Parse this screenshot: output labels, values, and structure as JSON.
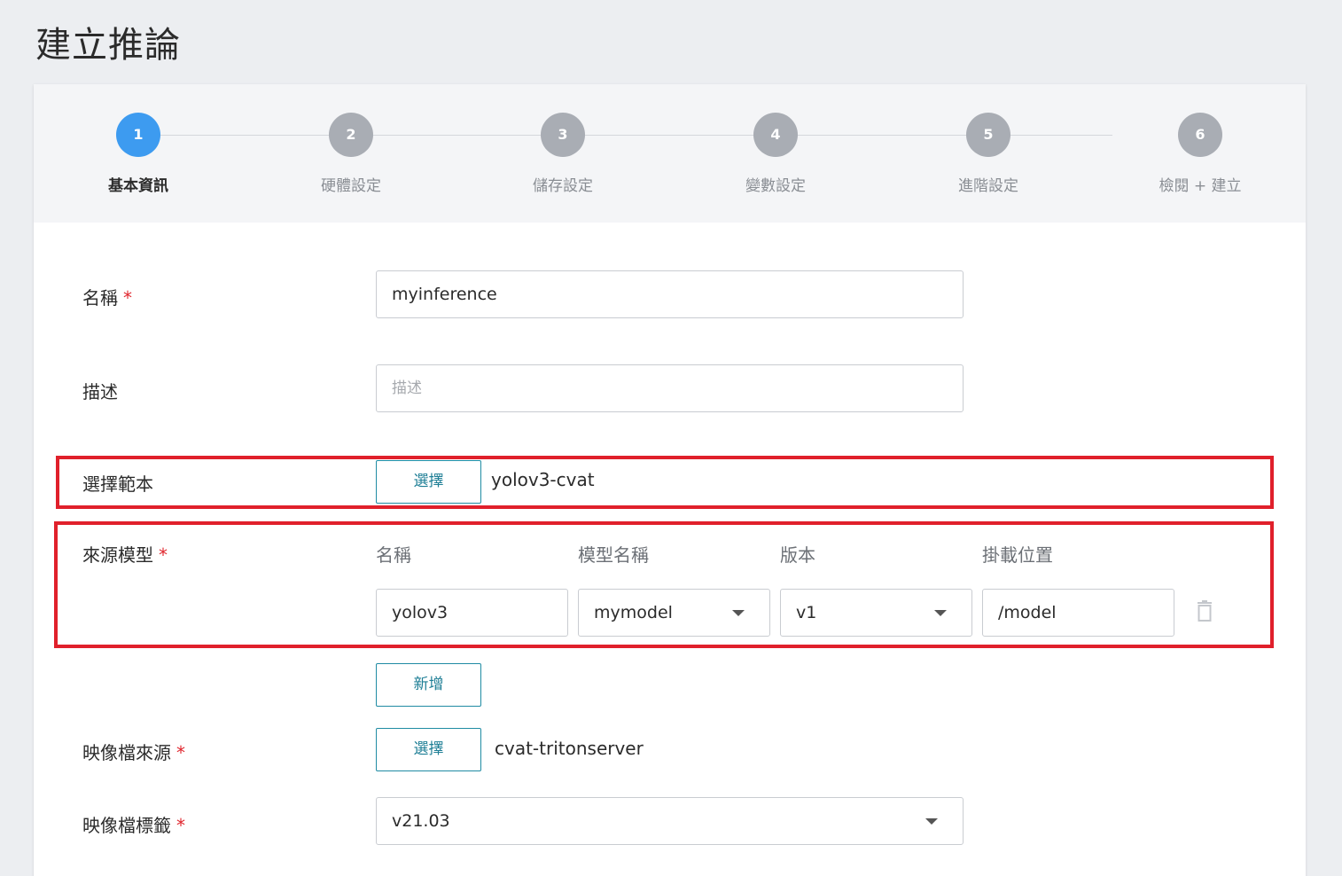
{
  "page": {
    "title": "建立推論"
  },
  "stepper": {
    "steps": [
      {
        "number": "1",
        "label": "基本資訊",
        "active": true
      },
      {
        "number": "2",
        "label": "硬體設定",
        "active": false
      },
      {
        "number": "3",
        "label": "儲存設定",
        "active": false
      },
      {
        "number": "4",
        "label": "變數設定",
        "active": false
      },
      {
        "number": "5",
        "label": "進階設定",
        "active": false
      },
      {
        "number": "6",
        "label": "檢閱 + 建立",
        "active": false
      }
    ]
  },
  "form": {
    "name": {
      "label": "名稱",
      "required_mark": "*",
      "value": "myinference"
    },
    "description": {
      "label": "描述",
      "placeholder": "描述",
      "value": ""
    },
    "template": {
      "label": "選擇範本",
      "button": "選擇",
      "selected": "yolov3-cvat"
    },
    "source_model": {
      "label": "來源模型",
      "required_mark": "*",
      "columns": [
        "名稱",
        "模型名稱",
        "版本",
        "掛載位置"
      ],
      "row": {
        "name": "yolov3",
        "model_name": "mymodel",
        "version": "v1",
        "mount_path": "/model"
      },
      "add_button": "新增"
    },
    "image_source": {
      "label": "映像檔來源",
      "required_mark": "*",
      "button": "選擇",
      "selected": "cvat-tritonserver"
    },
    "image_tag": {
      "label": "映像檔標籤",
      "required_mark": "*",
      "value": "v21.03"
    }
  },
  "colors": {
    "accent": "#3d9bf0",
    "button_text": "#1f7f96",
    "highlight": "#e0202b",
    "required": "#e0262e"
  },
  "icons": {
    "delete": "trash-icon",
    "dropdown": "caret-down-icon"
  }
}
